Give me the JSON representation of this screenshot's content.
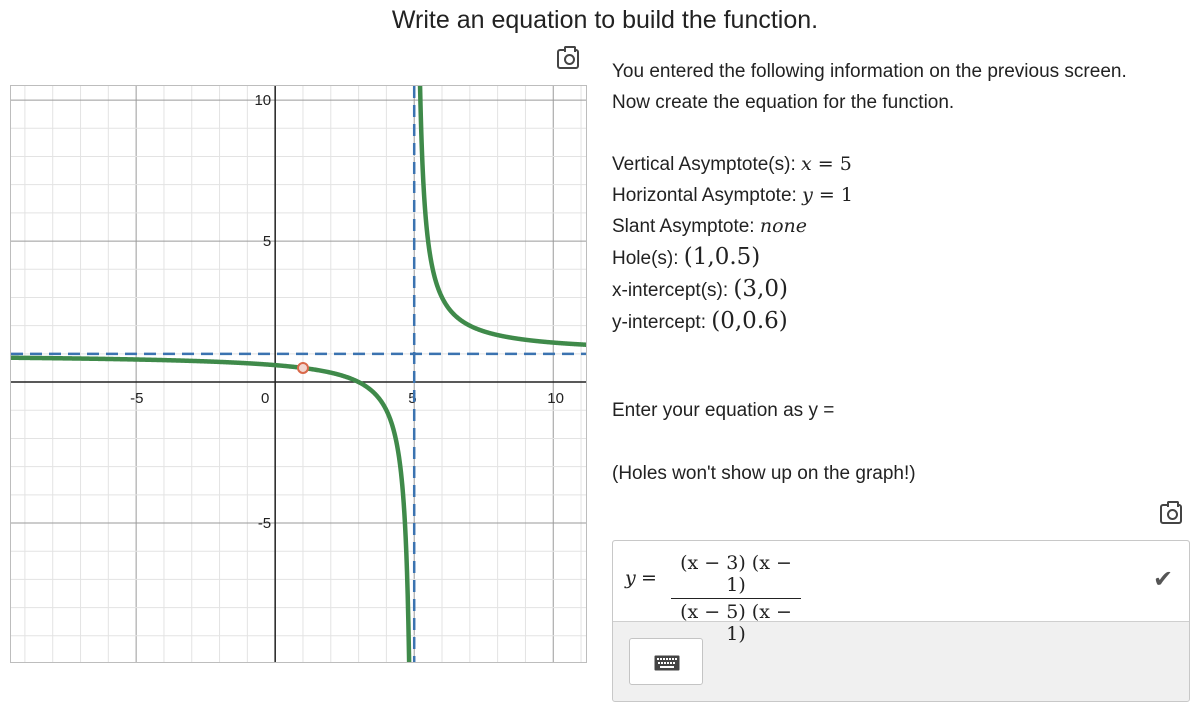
{
  "page": {
    "title": "Write an equation to build the function."
  },
  "info": {
    "intro_line1": "You entered the following information on the previous screen.",
    "intro_line2": "Now create the equation for the function.",
    "vertical": {
      "label": "Vertical Asymptote(s):",
      "var": "x",
      "value": "= 5"
    },
    "horizontal": {
      "label": "Horizontal Asymptote:",
      "var": "y",
      "value": "= 1"
    },
    "slant": {
      "label": "Slant Asymptote:",
      "value": "none"
    },
    "hole": {
      "label": "Hole(s):",
      "value": "(1,0.5)"
    },
    "xint": {
      "label": "x-intercept(s):",
      "value": "(3,0)"
    },
    "yint": {
      "label": "y-intercept:",
      "value": "(0,0.6)"
    },
    "prompt": "Enter your equation as y =",
    "note": "(Holes won't show up on the graph!)"
  },
  "answer": {
    "lhs": "y",
    "eq": "=",
    "numerator": "(x − 3) (x − 1)",
    "denominator": "(x − 5) (x − 1)",
    "check": "✔"
  },
  "icons": {
    "screenshot": "camera-icon",
    "keyboard": "keyboard-icon",
    "check": "check-icon"
  },
  "graph": {
    "x_ticks": [
      "-5",
      "0",
      "5",
      "10"
    ],
    "y_ticks": [
      "10",
      "5",
      "-5"
    ],
    "curve_color": "#3f8a4a",
    "asymptote_color": "#3b73b0",
    "hole_color": "#d9694a"
  },
  "chart_data": {
    "type": "line",
    "title": "",
    "xlabel": "",
    "ylabel": "",
    "xlim": [
      -9.5,
      11.25
    ],
    "ylim": [
      -10,
      10.5
    ],
    "grid": true,
    "function": "(x-3)(x-1)/((x-5)(x-1))",
    "vertical_asymptote": 5,
    "horizontal_asymptote": 1,
    "hole": [
      1,
      0.5
    ],
    "x_intercept": [
      3,
      0
    ],
    "y_intercept": [
      0,
      0.6
    ]
  }
}
